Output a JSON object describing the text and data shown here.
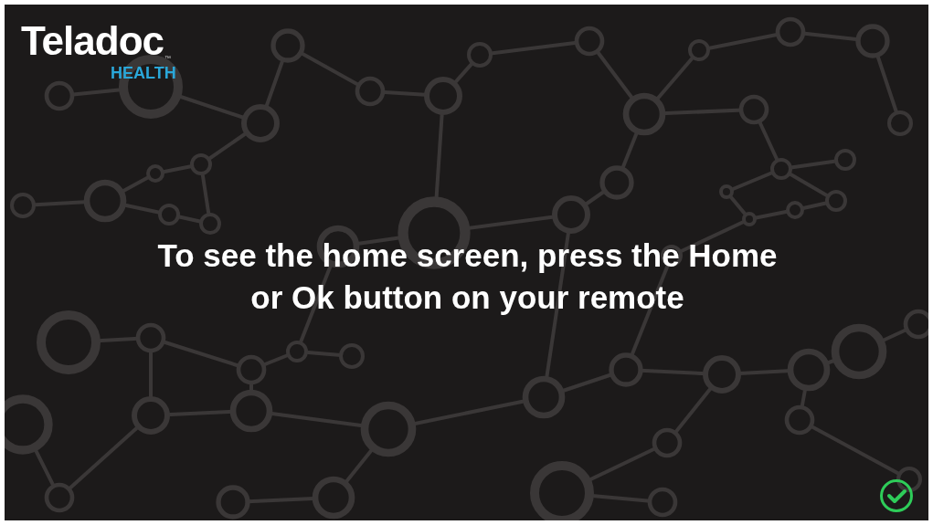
{
  "logo": {
    "name": "Teladoc",
    "trademark": "™",
    "subtitle": "HEALTH"
  },
  "message": "To see the home screen, press the Home or Ok button on your remote",
  "status": {
    "connected": true
  }
}
